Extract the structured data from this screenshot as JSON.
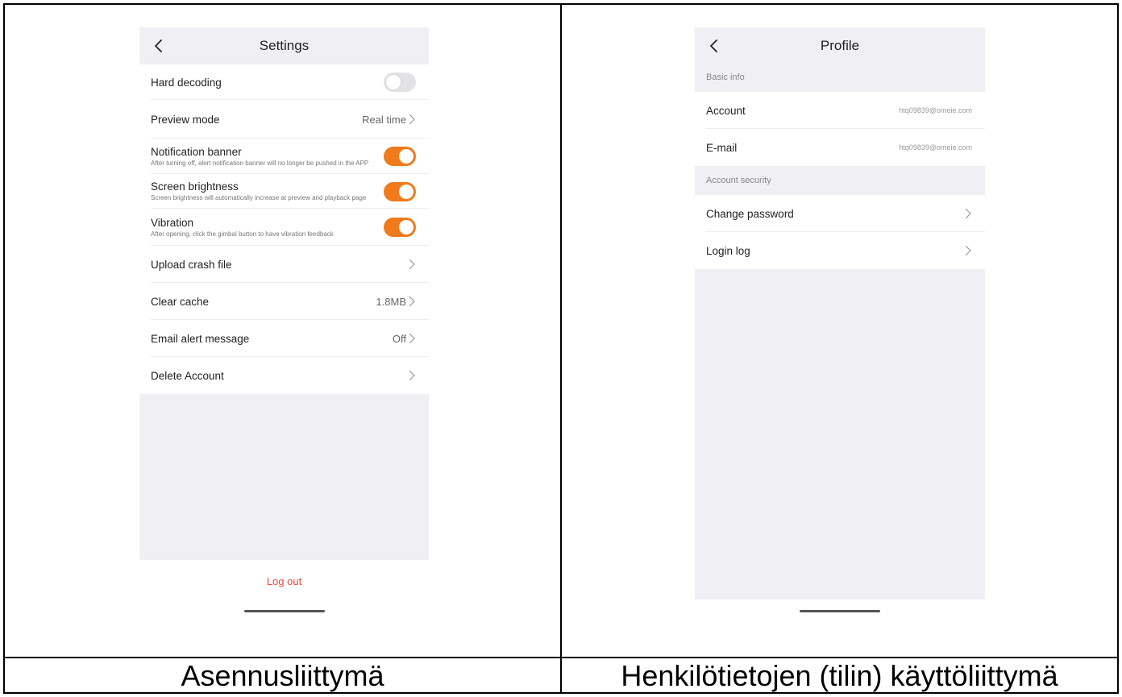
{
  "settings": {
    "title": "Settings",
    "rows": [
      {
        "label": "Hard decoding",
        "toggle": "off"
      },
      {
        "label": "Preview mode",
        "value": "Real time"
      },
      {
        "label": "Notification banner",
        "sub": "After turning off, alert notification banner will no longer be pushed in the APP",
        "toggle": "on"
      },
      {
        "label": "Screen brightness",
        "sub": "Screen brightness will automatically increase at preview and playback page",
        "toggle": "on"
      },
      {
        "label": "Vibration",
        "sub": "After opening, click the gimbal button to have vibration feedback",
        "toggle": "on"
      },
      {
        "label": "Upload crash file",
        "value": ""
      },
      {
        "label": "Clear cache",
        "value": "1.8MB"
      },
      {
        "label": "Email alert message",
        "value": "Off"
      },
      {
        "label": "Delete Account",
        "value": ""
      }
    ],
    "logout_label": "Log out"
  },
  "profile": {
    "title": "Profile",
    "basic_info_header": "Basic info",
    "account_label": "Account",
    "account_value": "htq09839@omeie.com",
    "email_label": "E-mail",
    "email_value": "htq09839@omeie.com",
    "security_header": "Account security",
    "change_password_label": "Change password",
    "login_log_label": "Login log"
  },
  "captions": {
    "left": "Asennusliittymä",
    "right": "Henkilötietojen (tilin) käyttöliittymä"
  },
  "colors": {
    "accent": "#f07a1c",
    "logout": "#e8473d",
    "section_bg": "#f0eff3"
  },
  "icons": {
    "back": "back-chevron-icon",
    "row_arrow": "chevron-right-icon"
  }
}
